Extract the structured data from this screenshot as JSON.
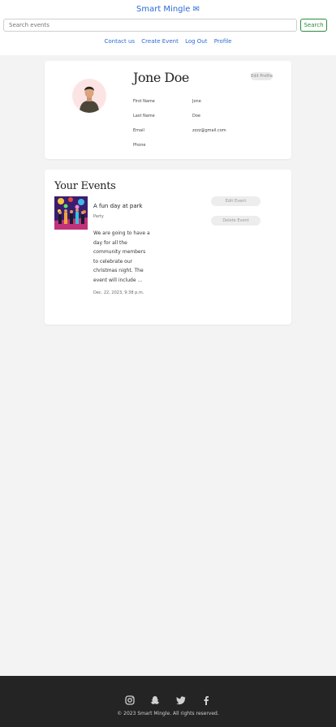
{
  "header": {
    "brand": "Smart Mingle ✉",
    "search_placeholder": "Search events",
    "search_button": "Search",
    "nav": [
      "Contact us",
      "Create Event",
      "Log Out",
      "Profile"
    ]
  },
  "profile": {
    "name": "Jone Doe",
    "edit_button": "Edit Profile",
    "fields": [
      {
        "label": "First Name",
        "value": "Jone"
      },
      {
        "label": "Last Name",
        "value": "Doe"
      },
      {
        "label": "Email",
        "value": "zzzz@gmail.com"
      },
      {
        "label": "Phone",
        "value": ""
      }
    ]
  },
  "events": {
    "title": "Your Events",
    "items": [
      {
        "title": "A fun day at park",
        "category": "Party",
        "description": "We are going to have a day for all the community members to celebrate our christmas night. The event will include ...",
        "date": "Dec. 22, 2023, 9:38 p.m.",
        "edit_button": "Edit Event",
        "delete_button": "Delete Event"
      }
    ]
  },
  "footer": {
    "icons": [
      "instagram-icon",
      "snapchat-icon",
      "twitter-icon",
      "facebook-icon"
    ],
    "copyright": "© 2023 Smart Mingle. All rights reserved."
  },
  "colors": {
    "link": "#2c6bd6",
    "search_button": "#2a8a3c",
    "footer_bg": "#242424",
    "page_bg": "#f3f3f3"
  }
}
